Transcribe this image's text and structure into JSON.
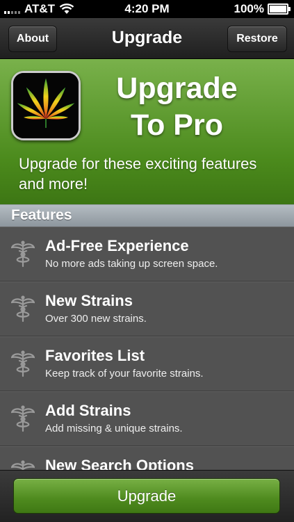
{
  "status_bar": {
    "carrier": "AT&T",
    "time": "4:20 PM",
    "battery": "100%"
  },
  "nav": {
    "title": "Upgrade",
    "back_label": "About",
    "right_label": "Restore"
  },
  "banner": {
    "title_line1": "Upgrade",
    "title_line2": "To Pro",
    "subtitle": "Upgrade for these exciting features and more!"
  },
  "section": {
    "title": "Features"
  },
  "features": [
    {
      "title": "Ad-Free Experience",
      "subtitle": "No more ads taking up screen space.",
      "icon": "caduceus-icon"
    },
    {
      "title": "New Strains",
      "subtitle": "Over 300 new strains.",
      "icon": "caduceus-icon"
    },
    {
      "title": "Favorites List",
      "subtitle": "Keep track of your favorite strains.",
      "icon": "caduceus-icon"
    },
    {
      "title": "Add Strains",
      "subtitle": "Add missing & unique strains.",
      "icon": "caduceus-icon"
    },
    {
      "title": "New Search Options",
      "subtitle": "",
      "icon": "caduceus-icon"
    }
  ],
  "toolbar": {
    "upgrade_label": "Upgrade"
  },
  "colors": {
    "accent_green": "#4e8a1e",
    "banner_green": "#5f9a2e",
    "list_bg": "#525252",
    "section_bg": "#9aa2a8"
  }
}
